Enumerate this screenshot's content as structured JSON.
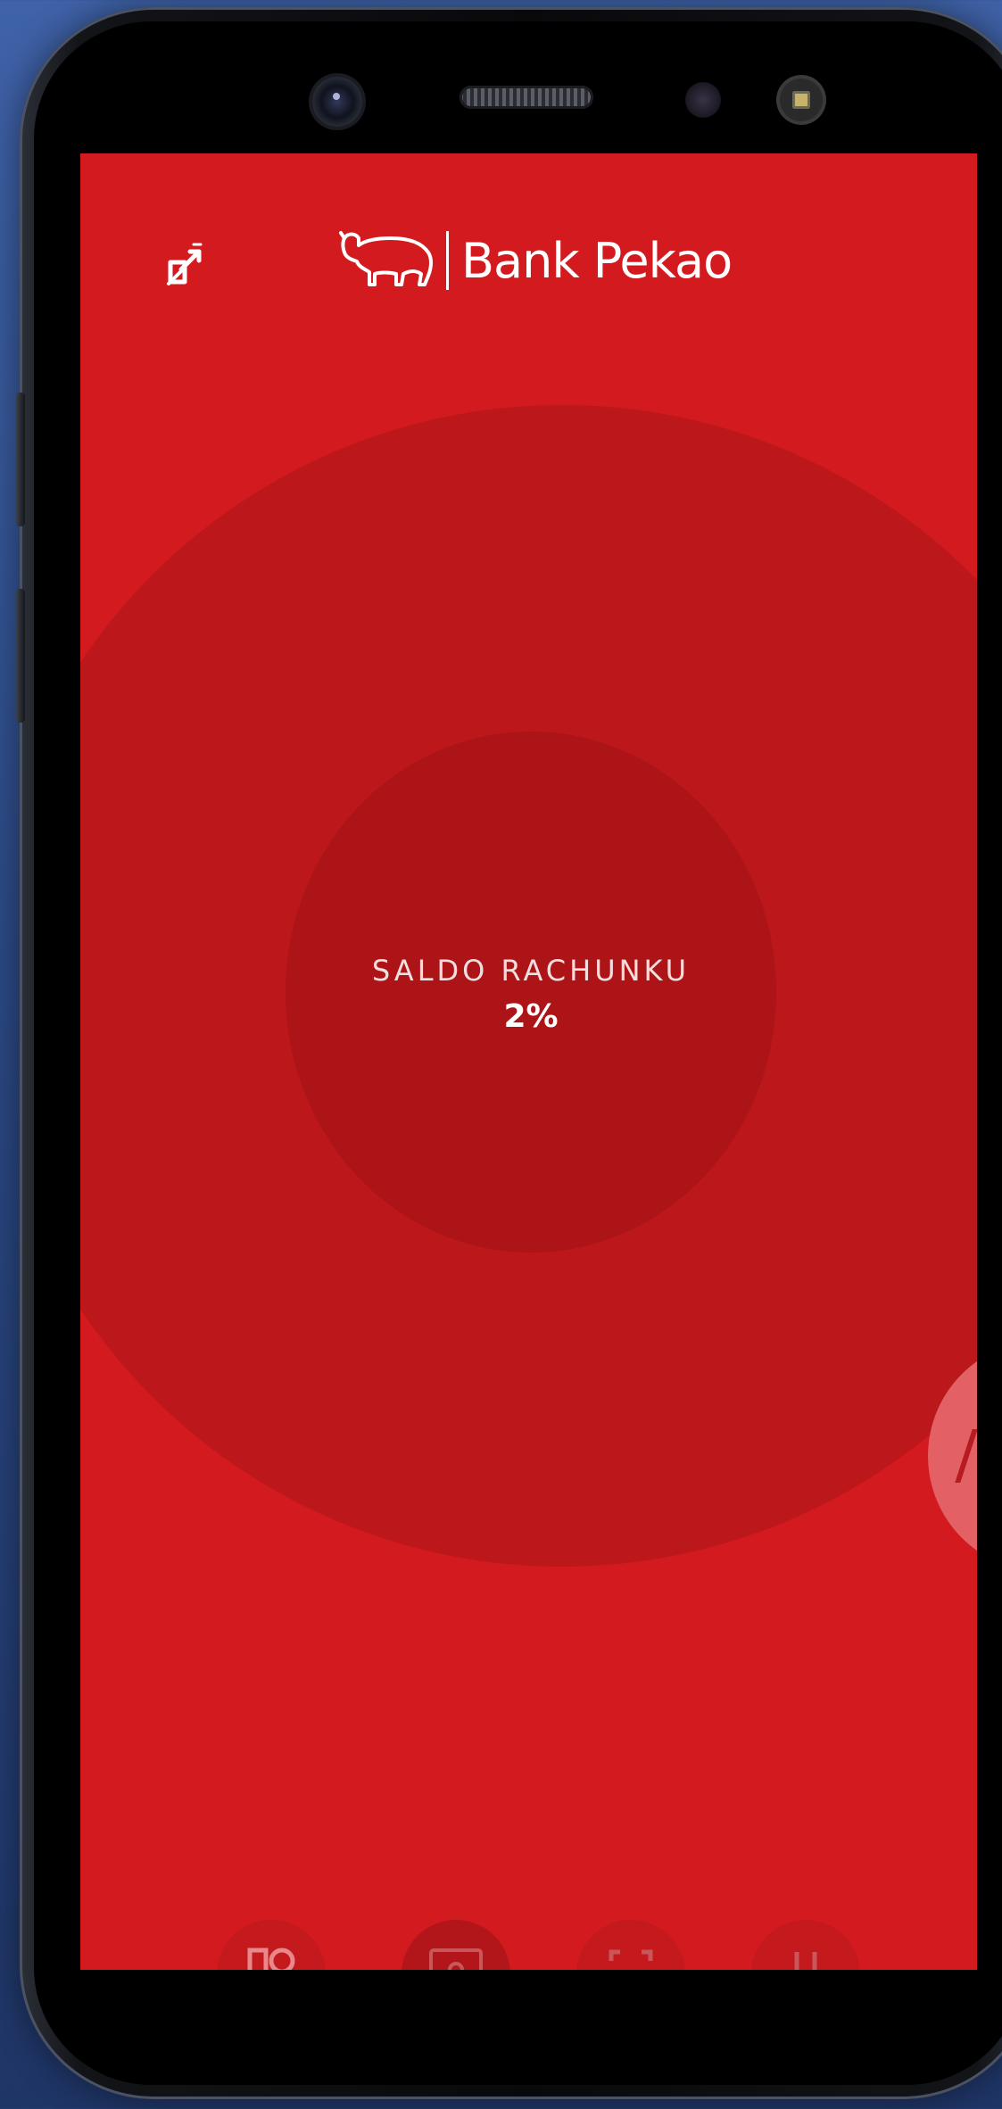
{
  "colors": {
    "brand_red": "#d31a1f",
    "outer_circle": "#bc171b",
    "inner_circle": "#ac1417",
    "text": "#ffffff"
  },
  "header": {
    "logo_text": "Bank Pekao",
    "back_icon": "tag-off-icon"
  },
  "balance": {
    "label": "SALDO RACHUNKU",
    "value": "2%"
  },
  "bottom_nav": {
    "items": [
      {
        "icon": "accounts-icon"
      },
      {
        "icon": "card-icon"
      },
      {
        "icon": "scan-icon"
      },
      {
        "icon": "menu-icon"
      }
    ]
  }
}
